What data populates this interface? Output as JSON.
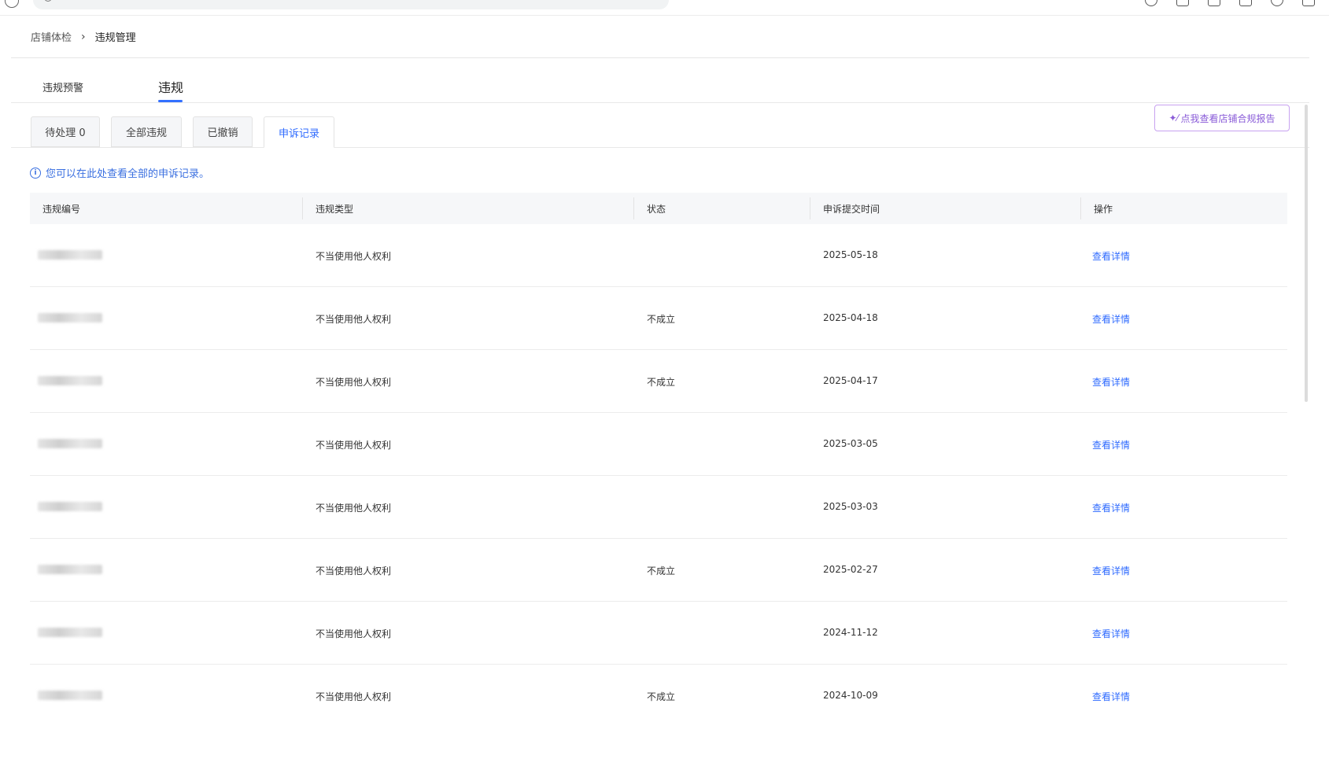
{
  "breadcrumb": {
    "parent": "店铺体检",
    "separator": "›",
    "current": "违规管理"
  },
  "main_tabs": [
    {
      "label": "违规预警",
      "active": false
    },
    {
      "label": "违规",
      "active": true
    }
  ],
  "sub_tabs": [
    {
      "label": "待处理 0",
      "active": false
    },
    {
      "label": "全部违规",
      "active": false
    },
    {
      "label": "已撤销",
      "active": false
    },
    {
      "label": "申诉记录",
      "active": true
    }
  ],
  "report_button": {
    "label": "点我查看店铺合规报告",
    "icon": "sparkle-icon"
  },
  "tip": {
    "icon": "info-icon",
    "text": "您可以在此处查看全部的申诉记录。"
  },
  "table": {
    "headers": [
      "违规编号",
      "违规类型",
      "状态",
      "申诉提交时间",
      "操作"
    ],
    "rows": [
      {
        "id": "",
        "type": "不当使用他人权利",
        "status": "",
        "date": "2025-05-18",
        "action": "查看详情"
      },
      {
        "id": "",
        "type": "不当使用他人权利",
        "status": "不成立",
        "date": "2025-04-18",
        "action": "查看详情"
      },
      {
        "id": "",
        "type": "不当使用他人权利",
        "status": "不成立",
        "date": "2025-04-17",
        "action": "查看详情"
      },
      {
        "id": "",
        "type": "不当使用他人权利",
        "status": "",
        "date": "2025-03-05",
        "action": "查看详情"
      },
      {
        "id": "",
        "type": "不当使用他人权利",
        "status": "",
        "date": "2025-03-03",
        "action": "查看详情"
      },
      {
        "id": "",
        "type": "不当使用他人权利",
        "status": "不成立",
        "date": "2025-02-27",
        "action": "查看详情"
      },
      {
        "id": "",
        "type": "不当使用他人权利",
        "status": "",
        "date": "2024-11-12",
        "action": "查看详情"
      },
      {
        "id": "",
        "type": "不当使用他人权利",
        "status": "不成立",
        "date": "2024-10-09",
        "action": "查看详情"
      }
    ]
  },
  "colors": {
    "accent": "#2f6bff",
    "report_border": "#c8a2f0",
    "report_text": "#8a5cd8"
  }
}
